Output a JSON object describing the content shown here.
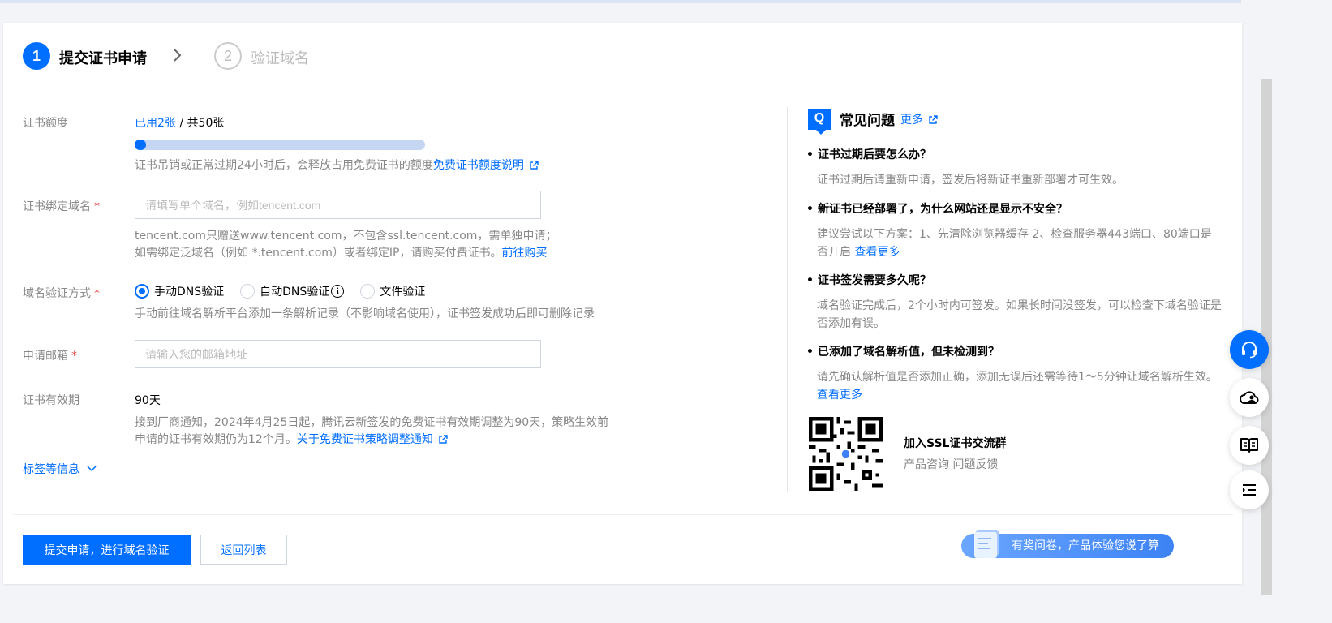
{
  "steps": [
    {
      "num": "1",
      "label": "提交证书申请"
    },
    {
      "num": "2",
      "label": "验证域名"
    }
  ],
  "form": {
    "quota": {
      "label": "证书额度",
      "used": "已用2张",
      "sep": " / ",
      "total": "共50张",
      "used_fraction": 0.04,
      "hint": "证书吊销或正常过期24小时后，会释放占用免费证书的额度",
      "hint_link": "免费证书额度说明"
    },
    "domain": {
      "label": "证书绑定域名",
      "required": "*",
      "placeholder": "请填写单个域名，例如tencent.com",
      "value": "",
      "hint_line1": "tencent.com只赠送www.tencent.com，不包含ssl.tencent.com，需单独申请；",
      "hint_line2": "如需绑定泛域名（例如 *.tencent.com）或者绑定IP，请购买付费证书。",
      "hint_link": "前往购买"
    },
    "verify": {
      "label": "域名验证方式",
      "required": "*",
      "options": [
        "手动DNS验证",
        "自动DNS验证",
        "文件验证"
      ],
      "selected": "手动DNS验证",
      "info_glyph": "i",
      "hint": "手动前往域名解析平台添加一条解析记录（不影响域名使用），证书签发成功后即可删除记录"
    },
    "email": {
      "label": "申请邮箱",
      "required": "*",
      "placeholder": "请输入您的邮箱地址",
      "value": ""
    },
    "validity": {
      "label": "证书有效期",
      "value": "90天",
      "hint_line1": "接到厂商通知，2024年4月25日起，腾讯云新签发的免费证书有效期调整为90天，策略生效前",
      "hint_line2": "申请的证书有效期仍为12个月。",
      "hint_link": "关于免费证书策略调整通知"
    },
    "tags_toggle": "标签等信息"
  },
  "faq": {
    "logo": "Q",
    "title": "常见问题",
    "more": "更多",
    "items": [
      {
        "q": "证书过期后要怎么办？",
        "a": "证书过期后请重新申请，签发后将新证书重新部署才可生效。",
        "more": ""
      },
      {
        "q": "新证书已经部署了，为什么网站还是显示不安全？",
        "a": "建议尝试以下方案：1、先清除浏览器缓存 2、检查服务器443端口、80端口是否开启",
        "more": "查看更多"
      },
      {
        "q": "证书签发需要多久呢？",
        "a": "域名验证完成后，2个小时内可签发。如果长时间没签发，可以检查下域名验证是否添加有误。",
        "more": ""
      },
      {
        "q": "已添加了域名解析值，但未检测到？",
        "a": "请先确认解析值是否添加正确，添加无误后还需等待1～5分钟让域名解析生效。",
        "more": "查看更多"
      }
    ],
    "group_title": "加入SSL证书交流群",
    "group_sub": "产品咨询 问题反馈"
  },
  "footer": {
    "submit": "提交申请，进行域名验证",
    "back": "返回列表",
    "survey": "有奖问卷，产品体验您说了算"
  },
  "floating": [
    "headset-icon",
    "cloud-user-icon",
    "book-icon",
    "list-indent-icon"
  ],
  "colors": {
    "accent": "#006eff",
    "required": "#e54545",
    "muted": "#888888"
  }
}
